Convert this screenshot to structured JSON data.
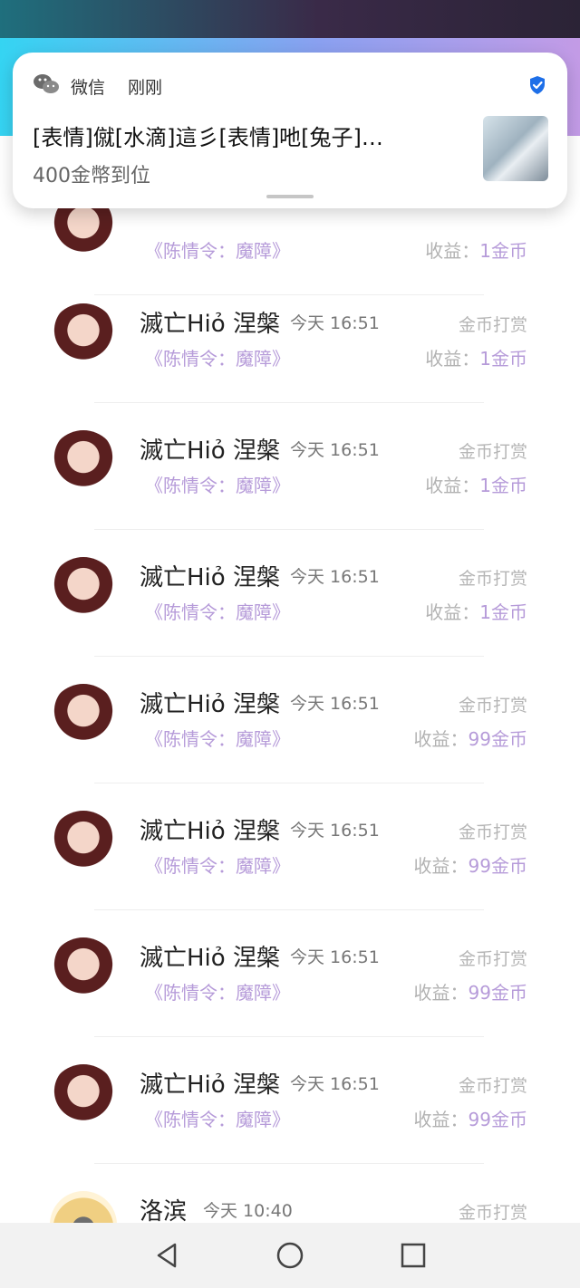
{
  "notification": {
    "app_name": "微信",
    "time": "刚刚",
    "message": "[表情]僦[水滴]這彡[表情]吔[兔子]…",
    "subtext": "400金幣到位"
  },
  "list": {
    "rows": [
      {
        "name": "",
        "time": "",
        "tag": "",
        "book": "《陈情令：魔障》",
        "income_label": "收益：",
        "income_value": "1金币"
      },
      {
        "name": "滅亡Hiỏ 涅槃",
        "time": "今天 16:51",
        "tag": "金币打赏",
        "book": "《陈情令：魔障》",
        "income_label": "收益：",
        "income_value": "1金币"
      },
      {
        "name": "滅亡Hiỏ 涅槃",
        "time": "今天 16:51",
        "tag": "金币打赏",
        "book": "《陈情令：魔障》",
        "income_label": "收益：",
        "income_value": "1金币"
      },
      {
        "name": "滅亡Hiỏ 涅槃",
        "time": "今天 16:51",
        "tag": "金币打赏",
        "book": "《陈情令：魔障》",
        "income_label": "收益：",
        "income_value": "1金币"
      },
      {
        "name": "滅亡Hiỏ 涅槃",
        "time": "今天 16:51",
        "tag": "金币打赏",
        "book": "《陈情令：魔障》",
        "income_label": "收益：",
        "income_value": "99金币"
      },
      {
        "name": "滅亡Hiỏ 涅槃",
        "time": "今天 16:51",
        "tag": "金币打赏",
        "book": "《陈情令：魔障》",
        "income_label": "收益：",
        "income_value": "99金币"
      },
      {
        "name": "滅亡Hiỏ 涅槃",
        "time": "今天 16:51",
        "tag": "金币打赏",
        "book": "《陈情令：魔障》",
        "income_label": "收益：",
        "income_value": "99金币"
      },
      {
        "name": "滅亡Hiỏ 涅槃",
        "time": "今天 16:51",
        "tag": "金币打赏",
        "book": "《陈情令：魔障》",
        "income_label": "收益：",
        "income_value": "99金币"
      },
      {
        "name": "洛滨",
        "time": "今天 10:40",
        "tag": "金币打赏",
        "book": "",
        "income_label": "",
        "income_value": ""
      }
    ]
  },
  "navigation": {
    "back_icon": "back-triangle-icon",
    "home_icon": "home-circle-icon",
    "recent_icon": "recent-square-icon"
  }
}
